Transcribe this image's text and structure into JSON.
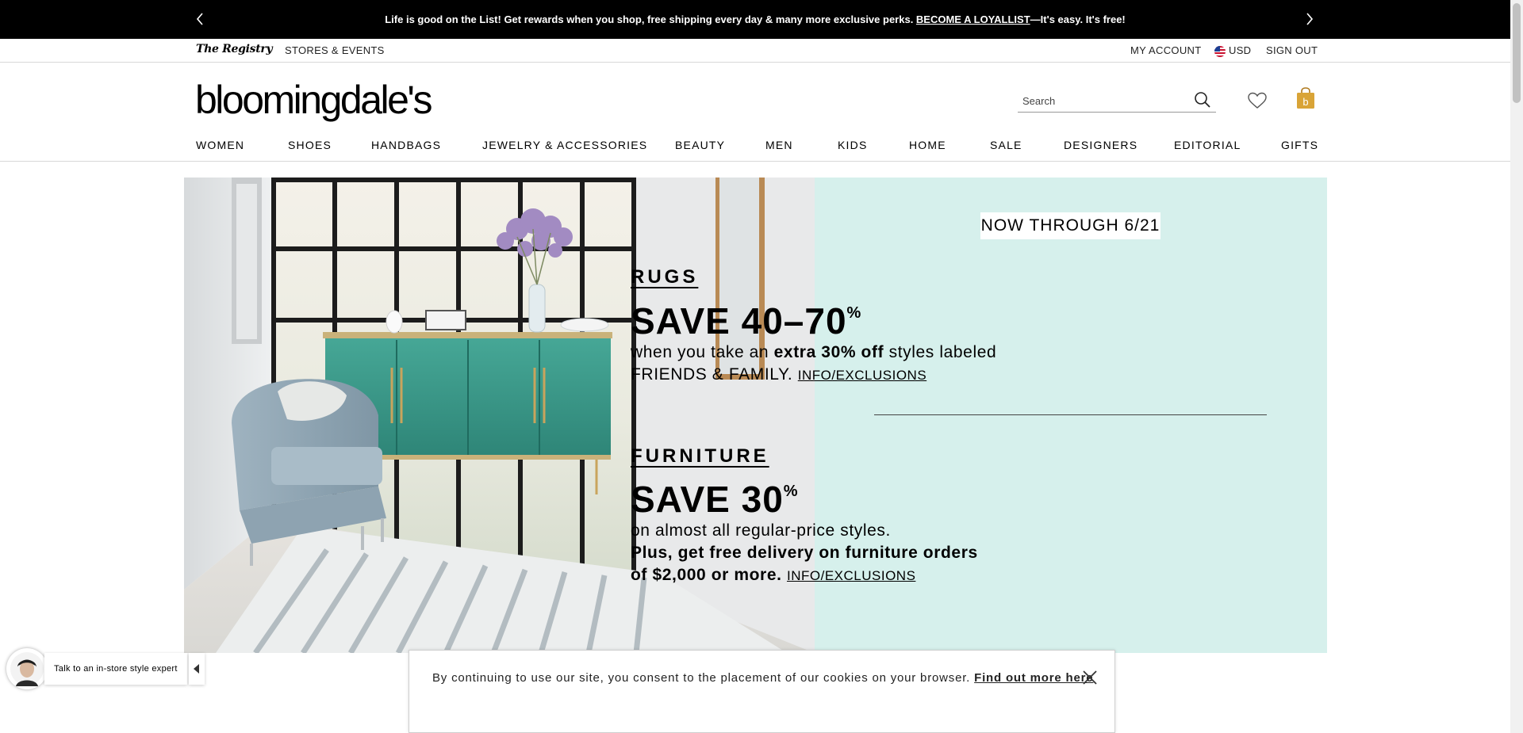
{
  "promo": {
    "text": "Life is good on the List! Get rewards when you shop, free shipping every day & many more exclusive perks. ",
    "link": "BECOME A LOYALLIST",
    "tail": "—It's easy. It's free!"
  },
  "utility": {
    "registry": "The Registry",
    "stores": "STORES & EVENTS",
    "account": "MY ACCOUNT",
    "currency": "USD",
    "signout": "SIGN OUT"
  },
  "header": {
    "logo": "bloomingdale's",
    "search_placeholder": "Search"
  },
  "nav": [
    "WOMEN",
    "SHOES",
    "HANDBAGS",
    "JEWELRY & ACCESSORIES",
    "BEAUTY",
    "MEN",
    "KIDS",
    "HOME",
    "SALE",
    "DESIGNERS",
    "EDITORIAL",
    "GIFTS"
  ],
  "hero": {
    "badge": "NOW THROUGH 6/21",
    "rugs": {
      "title": "RUGS",
      "save": "SAVE 40–70",
      "pct": "%",
      "line1_pre": "when you take an ",
      "line1_bold": "extra 30% off",
      "line1_post": " styles labeled",
      "line2": "FRIENDS & FAMILY.",
      "link": "INFO/EXCLUSIONS"
    },
    "furniture": {
      "title": "FURNITURE",
      "save": "SAVE 30",
      "pct": "%",
      "line1": "on almost all regular-price styles.",
      "line2": "Plus, get free delivery on furniture orders",
      "line3": "of $2,000 or more.",
      "link": "INFO/EXCLUSIONS"
    }
  },
  "chat": {
    "label": "Talk to an in-store style expert"
  },
  "cookie": {
    "text": "By continuing to use our site, you consent to the placement of our cookies on your browser. ",
    "link": "Find out more here"
  }
}
